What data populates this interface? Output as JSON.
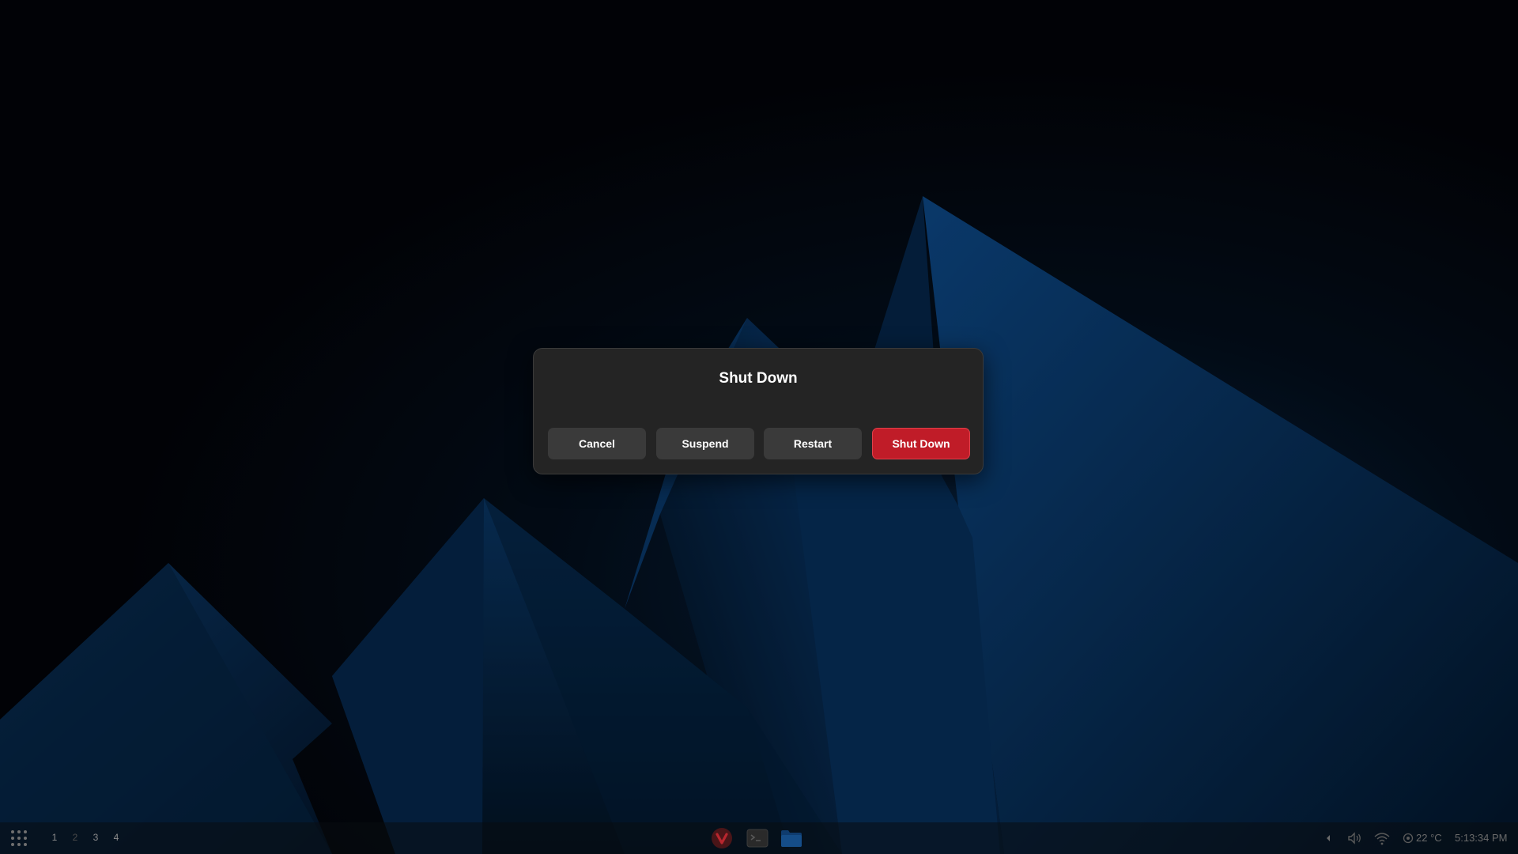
{
  "dialog": {
    "title": "Shut Down",
    "buttons": {
      "cancel": "Cancel",
      "suspend": "Suspend",
      "restart": "Restart",
      "shutdown": "Shut Down"
    },
    "destructive_color": "#c01c28"
  },
  "taskbar": {
    "workspaces": [
      "1",
      "2",
      "3",
      "4"
    ],
    "active_workspace": "2",
    "dock": [
      {
        "icon": "vivaldi-icon"
      },
      {
        "icon": "terminal-icon"
      },
      {
        "icon": "folder-icon"
      }
    ],
    "tray": {
      "temperature": "22 °C",
      "clock": "5:13:34 PM"
    }
  },
  "colors": {
    "wallpaper_base": "#020409",
    "wallpaper_accent": "#0d4a8a",
    "dialog_bg": "#242424",
    "button_bg": "#3a3a3a"
  }
}
